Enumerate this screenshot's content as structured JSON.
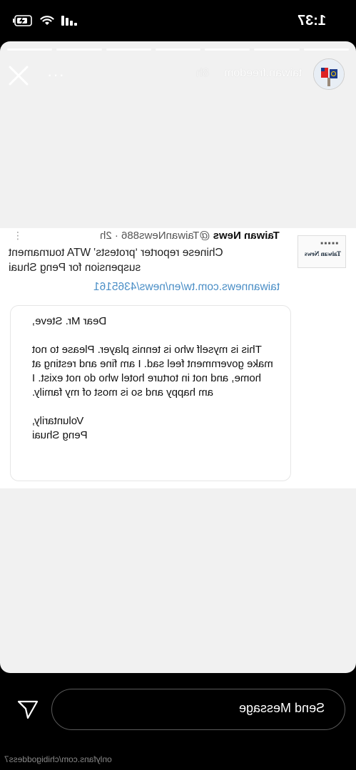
{
  "status_bar": {
    "time": "1:37",
    "icons": [
      "signal-icon",
      "wifi-icon",
      "battery-charging-icon"
    ]
  },
  "story": {
    "username": "taiwan.freedom",
    "time_ago": "8h",
    "more_label": "···",
    "progress_segments": 7
  },
  "tweet": {
    "author_name": "Taiwan News",
    "author_handle": "@TaiwanNews886",
    "time": "· 2h",
    "body": "Chinese reporter ‘protests’ WTA tournament suspension for Peng Shuai",
    "link": "taiwannews.com.tw/en/news/4365161",
    "logo_text": "Taiwan News"
  },
  "letter": {
    "greeting": "Dear Mr. Steve,",
    "body": "This is myself who is tennis player. Please to not make government feel sad. I am fine and resting at home, and not in torture hotel who do not exist. I am happy and so is most of my family.",
    "closing": "Voluntarily,",
    "signature": "Peng Shuai"
  },
  "composer": {
    "placeholder": "Send Message"
  },
  "watermark": "onlyfans.com/chibigoddess7",
  "colors": {
    "link": "#4a8ec6",
    "background": "#000000",
    "card": "#f1f1f1"
  }
}
